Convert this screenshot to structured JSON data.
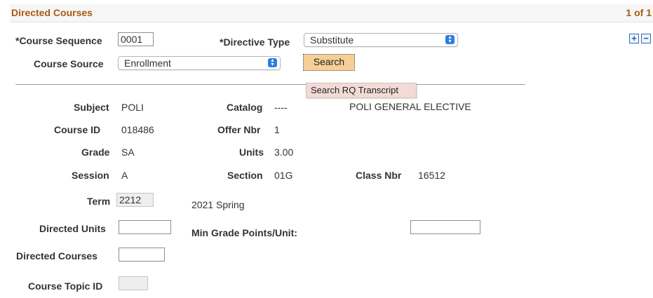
{
  "header": {
    "title": "Directed Courses",
    "page_count": "1 of 1"
  },
  "controls": {
    "plus_icon": "+",
    "minus_icon": "−"
  },
  "form": {
    "course_sequence_label": "*Course Sequence",
    "course_sequence_value": "0001",
    "directive_type_label": "*Directive Type",
    "directive_type_value": "Substitute",
    "course_source_label": "Course Source",
    "course_source_value": "Enrollment",
    "search_label": "Search",
    "tooltip": "Search RQ Transcript"
  },
  "details": {
    "subject_label": "Subject",
    "subject_value": "POLI",
    "catalog_label": "Catalog",
    "catalog_value": "----",
    "course_title": "POLI GENERAL ELECTIVE",
    "course_id_label": "Course ID",
    "course_id_value": "018486",
    "offer_nbr_label": "Offer Nbr",
    "offer_nbr_value": "1",
    "grade_label": "Grade",
    "grade_value": "SA",
    "units_label": "Units",
    "units_value": "3.00",
    "session_label": "Session",
    "session_value": "A",
    "section_label": "Section",
    "section_value": "01G",
    "class_nbr_label": "Class Nbr",
    "class_nbr_value": "16512",
    "term_label": "Term",
    "term_value": "2212",
    "term_desc": "2021 Spring",
    "directed_units_label": "Directed Units",
    "directed_units_value": "",
    "min_grade_label": "Min Grade Points/Unit:",
    "min_grade_value": "",
    "directed_courses_label": "Directed Courses",
    "directed_courses_value": "",
    "course_topic_label": "Course Topic ID",
    "course_topic_value": ""
  }
}
